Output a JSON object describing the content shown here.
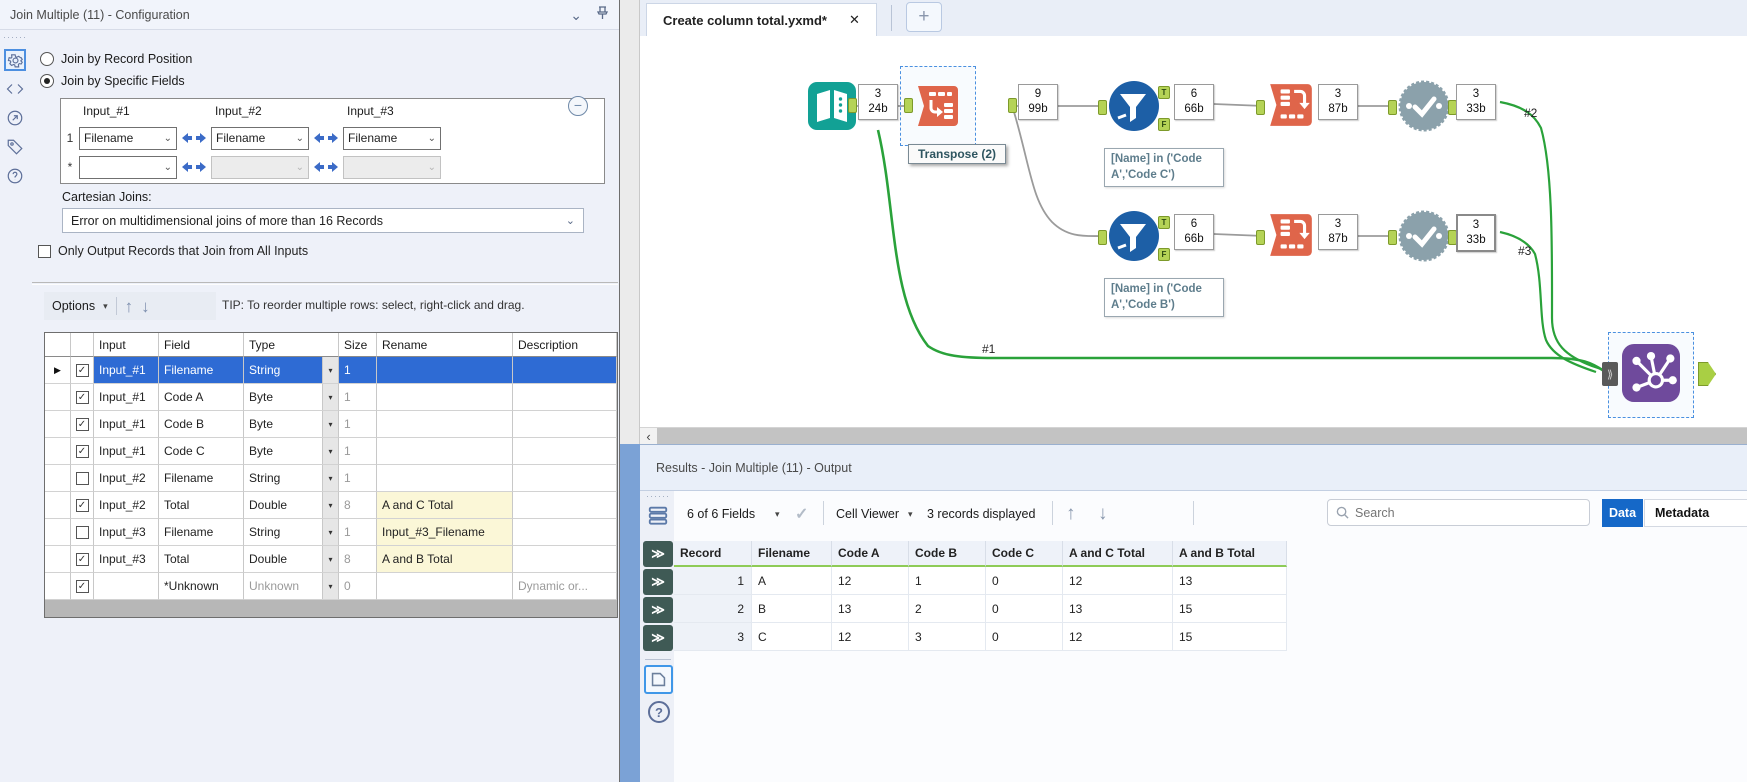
{
  "icons": {
    "close": "✕",
    "plus": "+",
    "caret_down": "▾",
    "chevron_down": "⌄",
    "up_arrow": "↑",
    "down_arrow": "↓",
    "check": "✓",
    "double_chevron": "≫",
    "minus": "−",
    "question": "?",
    "scroll_left": "‹",
    "grip_dots": "······",
    "row_pointer": "▶",
    "search_placeholder_icon": "search-icon"
  },
  "config": {
    "title": "Join Multiple (11) - Configuration",
    "radio_record_position": "Join by Record Position",
    "radio_specific_fields": "Join by Specific Fields",
    "join_fields": {
      "columns": [
        "Input_#1",
        "Input_#2",
        "Input_#3"
      ],
      "rows": [
        {
          "index": "1",
          "values": [
            "Filename",
            "Filename",
            "Filename"
          ]
        },
        {
          "index": "*",
          "values": [
            "",
            "",
            ""
          ]
        }
      ]
    },
    "cartesian_label": "Cartesian Joins:",
    "cartesian_value": "Error on multidimensional joins of more than 16 Records",
    "only_output_label": "Only Output Records that Join from All Inputs",
    "options_label": "Options",
    "tip": "TIP: To reorder multiple rows: select, right-click and drag.",
    "grid": {
      "columns": [
        "Input",
        "Field",
        "Type",
        "Size",
        "Rename",
        "Description"
      ],
      "rows": [
        {
          "checked": true,
          "input": "Input_#1",
          "field": "Filename",
          "type": "String",
          "size": "1",
          "rename": "",
          "description": "",
          "selected": true
        },
        {
          "checked": true,
          "input": "Input_#1",
          "field": "Code A",
          "type": "Byte",
          "size": "1",
          "rename": "",
          "description": ""
        },
        {
          "checked": true,
          "input": "Input_#1",
          "field": "Code B",
          "type": "Byte",
          "size": "1",
          "rename": "",
          "description": ""
        },
        {
          "checked": true,
          "input": "Input_#1",
          "field": "Code C",
          "type": "Byte",
          "size": "1",
          "rename": "",
          "description": ""
        },
        {
          "checked": false,
          "input": "Input_#2",
          "field": "Filename",
          "type": "String",
          "size": "1",
          "rename": "",
          "description": ""
        },
        {
          "checked": true,
          "input": "Input_#2",
          "field": "Total",
          "type": "Double",
          "size": "8",
          "rename": "A and C Total",
          "description": "",
          "rename_highlight": true
        },
        {
          "checked": false,
          "input": "Input_#3",
          "field": "Filename",
          "type": "String",
          "size": "1",
          "rename": "Input_#3_Filename",
          "description": "",
          "rename_highlight": true
        },
        {
          "checked": true,
          "input": "Input_#3",
          "field": "Total",
          "type": "Double",
          "size": "8",
          "rename": "A and B Total",
          "description": "",
          "rename_highlight": true
        },
        {
          "checked": true,
          "input": "",
          "field": "*Unknown",
          "type": "Unknown",
          "size": "0",
          "rename": "",
          "description": "Dynamic or...",
          "muted": true
        }
      ]
    }
  },
  "canvas": {
    "tab_title": "Create column total.yxmd*",
    "tooltip": "Transpose (2)",
    "annotations": [
      "[Name] in ('Code A','Code C')",
      "[Name] in ('Code A','Code B')"
    ],
    "connection_labels": {
      "c1": "#1",
      "c2": "#2",
      "c3": "#3"
    },
    "anchor_labels": {
      "t": "T",
      "f": "F"
    },
    "badges": {
      "input": {
        "records": "3",
        "size": "24b"
      },
      "transpose": {
        "records": "9",
        "size": "99b"
      },
      "filter1": {
        "records": "6",
        "size": "66b"
      },
      "crosstab1": {
        "records": "3",
        "size": "87b"
      },
      "check1": {
        "records": "3",
        "size": "33b"
      },
      "filter2": {
        "records": "6",
        "size": "66b"
      },
      "crosstab2": {
        "records": "3",
        "size": "87b"
      },
      "check2": {
        "records": "3",
        "size": "33b"
      }
    },
    "tool_names": [
      "input-data-tool",
      "transpose-tool",
      "filter-tool",
      "cross-tab-tool",
      "check-tool",
      "join-multiple-tool"
    ]
  },
  "results": {
    "title": "Results - Join Multiple (11) - Output",
    "fields_summary": "6 of 6 Fields",
    "cell_viewer": "Cell Viewer",
    "records_displayed": "3 records displayed",
    "search_placeholder": "Search",
    "data_tab": "Data",
    "metadata_tab": "Metadata",
    "table": {
      "columns": [
        "Record",
        "Filename",
        "Code A",
        "Code B",
        "Code C",
        "A and C Total",
        "A and B Total"
      ],
      "rows": [
        [
          "1",
          "A",
          "12",
          "1",
          "0",
          "12",
          "13"
        ],
        [
          "2",
          "B",
          "13",
          "2",
          "0",
          "13",
          "15"
        ],
        [
          "3",
          "C",
          "12",
          "3",
          "0",
          "12",
          "15"
        ]
      ]
    }
  },
  "colors": {
    "selection_blue": "#2e6bd4",
    "rename_highlight": "#fbf7d7",
    "connection_green": "#2aa23a",
    "connection_gray": "#9b9b9b",
    "data_tab_blue": "#1568c8",
    "tool_teal": "#12a195",
    "tool_orange": "#df654a",
    "tool_blue": "#1d5fa6",
    "tool_gray": "#8ba1ab",
    "tool_purple": "#6f4a9c",
    "anchor_green": "#b5d356",
    "header_underline_green": "#8ecb57"
  }
}
